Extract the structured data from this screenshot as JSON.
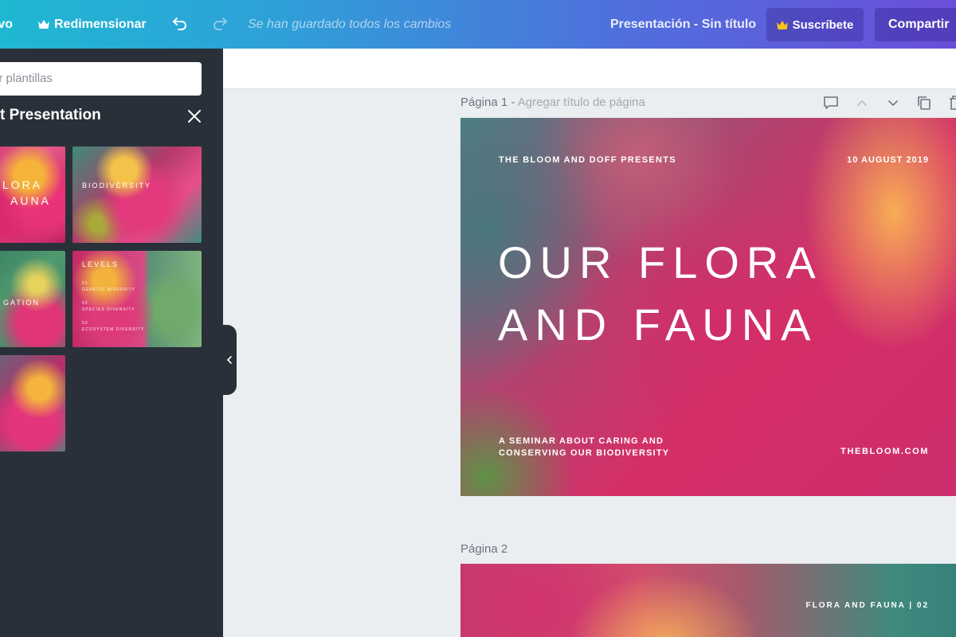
{
  "topbar": {
    "file_label": "vo",
    "resize_label": "Redimensionar",
    "saved_status": "Se han guardado todos los cambios",
    "doc_title": "Presentación - Sin título",
    "subscribe_label": "Suscríbete",
    "share_label": "Compartir",
    "colors": {
      "gradient_start": "#1fb8d3",
      "gradient_end": "#6b4fd9",
      "crown": "#f5c518"
    }
  },
  "panel": {
    "search_placeholder": "ar plantillas",
    "title": "t Presentation",
    "thumbnails": [
      {
        "line1": "LORA",
        "line2": "AUNA"
      },
      {
        "heading": "BIODIVERSITY"
      },
      {
        "heading": "GATION"
      },
      {
        "heading": "LEVELS",
        "items": [
          "01",
          "GENETIC DIVERSITY",
          "02",
          "SPECIES DIVERSITY",
          "03",
          "ECOSYSTEM DIVERSITY"
        ]
      },
      {
        "heading": ""
      }
    ]
  },
  "pages": [
    {
      "label": "Página 1 -",
      "add_title": "Agregar título de página",
      "slide": {
        "presents": "THE BLOOM AND DOFF PRESENTS",
        "date": "10 AUGUST 2019",
        "title_line1": "OUR FLORA",
        "title_line2": "AND FAUNA",
        "subtitle_line1": "A SEMINAR ABOUT CARING AND",
        "subtitle_line2": "CONSERVING OUR BIODIVERSITY",
        "website": "THEBLOOM.COM"
      }
    },
    {
      "label": "Página 2",
      "slide": {
        "label": "FLORA AND FAUNA | 02"
      }
    }
  ]
}
